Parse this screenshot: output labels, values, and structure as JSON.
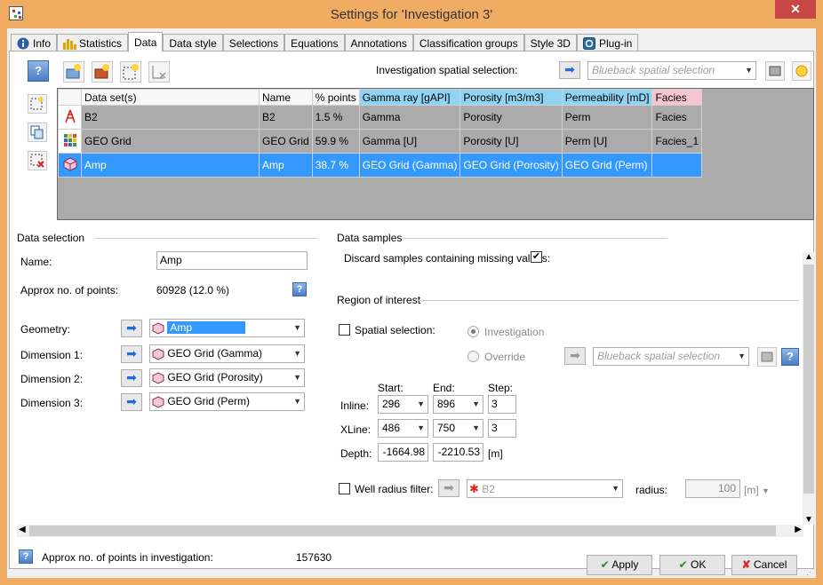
{
  "window": {
    "title": "Settings for 'Investigation 3'",
    "close": "✕"
  },
  "tabs": [
    "Info",
    "Statistics",
    "Data",
    "Data style",
    "Selections",
    "Equations",
    "Annotations",
    "Classification groups",
    "Style 3D",
    "Plug-in"
  ],
  "toolbar": {
    "spatial_label": "Investigation spatial selection:",
    "spatial_placeholder": "Blueback spatial selection"
  },
  "grid": {
    "headers": [
      "Data set(s)",
      "Name",
      "% points",
      "Gamma ray [gAPI]",
      "Porosity [m3/m3]",
      "Permeability [mD]",
      "Facies"
    ],
    "header_colors": [
      "#f7f7f7",
      "#f7f7f7",
      "#f7f7f7",
      "#8fd3f5",
      "#8fd3f5",
      "#8fd3f5",
      "#f5c6d0"
    ],
    "rows": [
      {
        "dataset": "B2",
        "name": "B2",
        "pct": "1.5 %",
        "gamma": "Gamma",
        "porosity": "Porosity",
        "perm": "Perm",
        "facies": "Facies",
        "icon": "well-icon"
      },
      {
        "dataset": "GEO Grid",
        "name": "GEO Grid",
        "pct": "59.9 %",
        "gamma": "Gamma [U]",
        "porosity": "Porosity [U]",
        "perm": "Perm [U]",
        "facies": "Facies_1",
        "icon": "grid-icon"
      },
      {
        "dataset": "Amp",
        "name": "Amp",
        "pct": "38.7 %",
        "gamma": "GEO Grid (Gamma)",
        "porosity": "GEO Grid (Porosity)",
        "perm": "GEO Grid (Perm)",
        "facies": "",
        "icon": "cube-icon"
      }
    ]
  },
  "data_selection": {
    "title": "Data selection",
    "name_label": "Name:",
    "name_value": "Amp",
    "approx_label": "Approx no. of points:",
    "approx_value": "60928 (12.0 %)",
    "geometry_label": "Geometry:",
    "geometry_value": "Amp",
    "dim1_label": "Dimension 1:",
    "dim1_value": "GEO Grid (Gamma)",
    "dim2_label": "Dimension 2:",
    "dim2_value": "GEO Grid (Porosity)",
    "dim3_label": "Dimension 3:",
    "dim3_value": "GEO Grid (Perm)"
  },
  "data_samples": {
    "title": "Data samples",
    "discard_label": "Discard samples containing missing values:",
    "discard_checked": "✔"
  },
  "roi": {
    "title": "Region of interest",
    "spatial_label": "Spatial selection:",
    "investigation_label": "Investigation",
    "override_label": "Override",
    "override_placeholder": "Blueback spatial selection",
    "start_label": "Start:",
    "end_label": "End:",
    "step_label": "Step:",
    "inline_label": "Inline:",
    "inline_start": "296",
    "inline_end": "896",
    "inline_step": "3",
    "xline_label": "XLine:",
    "xline_start": "486",
    "xline_end": "750",
    "xline_step": "3",
    "depth_label": "Depth:",
    "depth_start": "-1664.98",
    "depth_end": "-2210.53",
    "depth_unit": "[m]",
    "well_label": "Well radius filter:",
    "well_value": "B2",
    "radius_label": "radius:",
    "radius_value": "100",
    "radius_unit": "[m]"
  },
  "footer": {
    "investigation_label": "Approx no. of points in investigation:",
    "investigation_value": "157630",
    "apply": "Apply",
    "ok": "OK",
    "cancel": "Cancel"
  }
}
